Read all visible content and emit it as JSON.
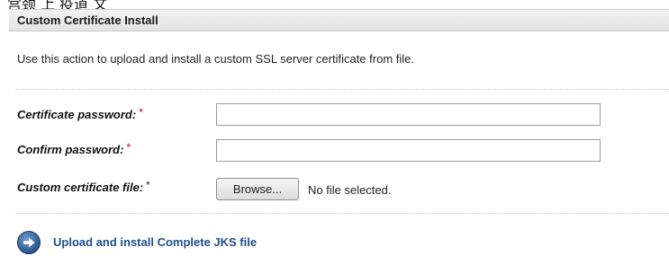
{
  "top_strip": {
    "fragment": "宫颈 上 疫道 文"
  },
  "panel": {
    "title": "Custom Certificate Install",
    "description": "Use this action to upload and install a custom SSL server certificate from file."
  },
  "form": {
    "certificate_password": {
      "label": "Certificate password:",
      "required_mark": "*",
      "value": "",
      "placeholder": ""
    },
    "confirm_password": {
      "label": "Confirm password:",
      "required_mark": "*",
      "value": "",
      "placeholder": ""
    },
    "certificate_file": {
      "label": "Custom certificate file:",
      "required_mark": "*",
      "browse_label": "Browse...",
      "status": "No file selected."
    }
  },
  "action": {
    "label": "Upload and install Complete JKS file",
    "icon": "arrow-right-circle-icon"
  },
  "colors": {
    "required_mark": "#d40000",
    "action_text": "#1f4f8a",
    "action_icon": "#2d5a94",
    "header_bg": "#e6e6e6"
  }
}
